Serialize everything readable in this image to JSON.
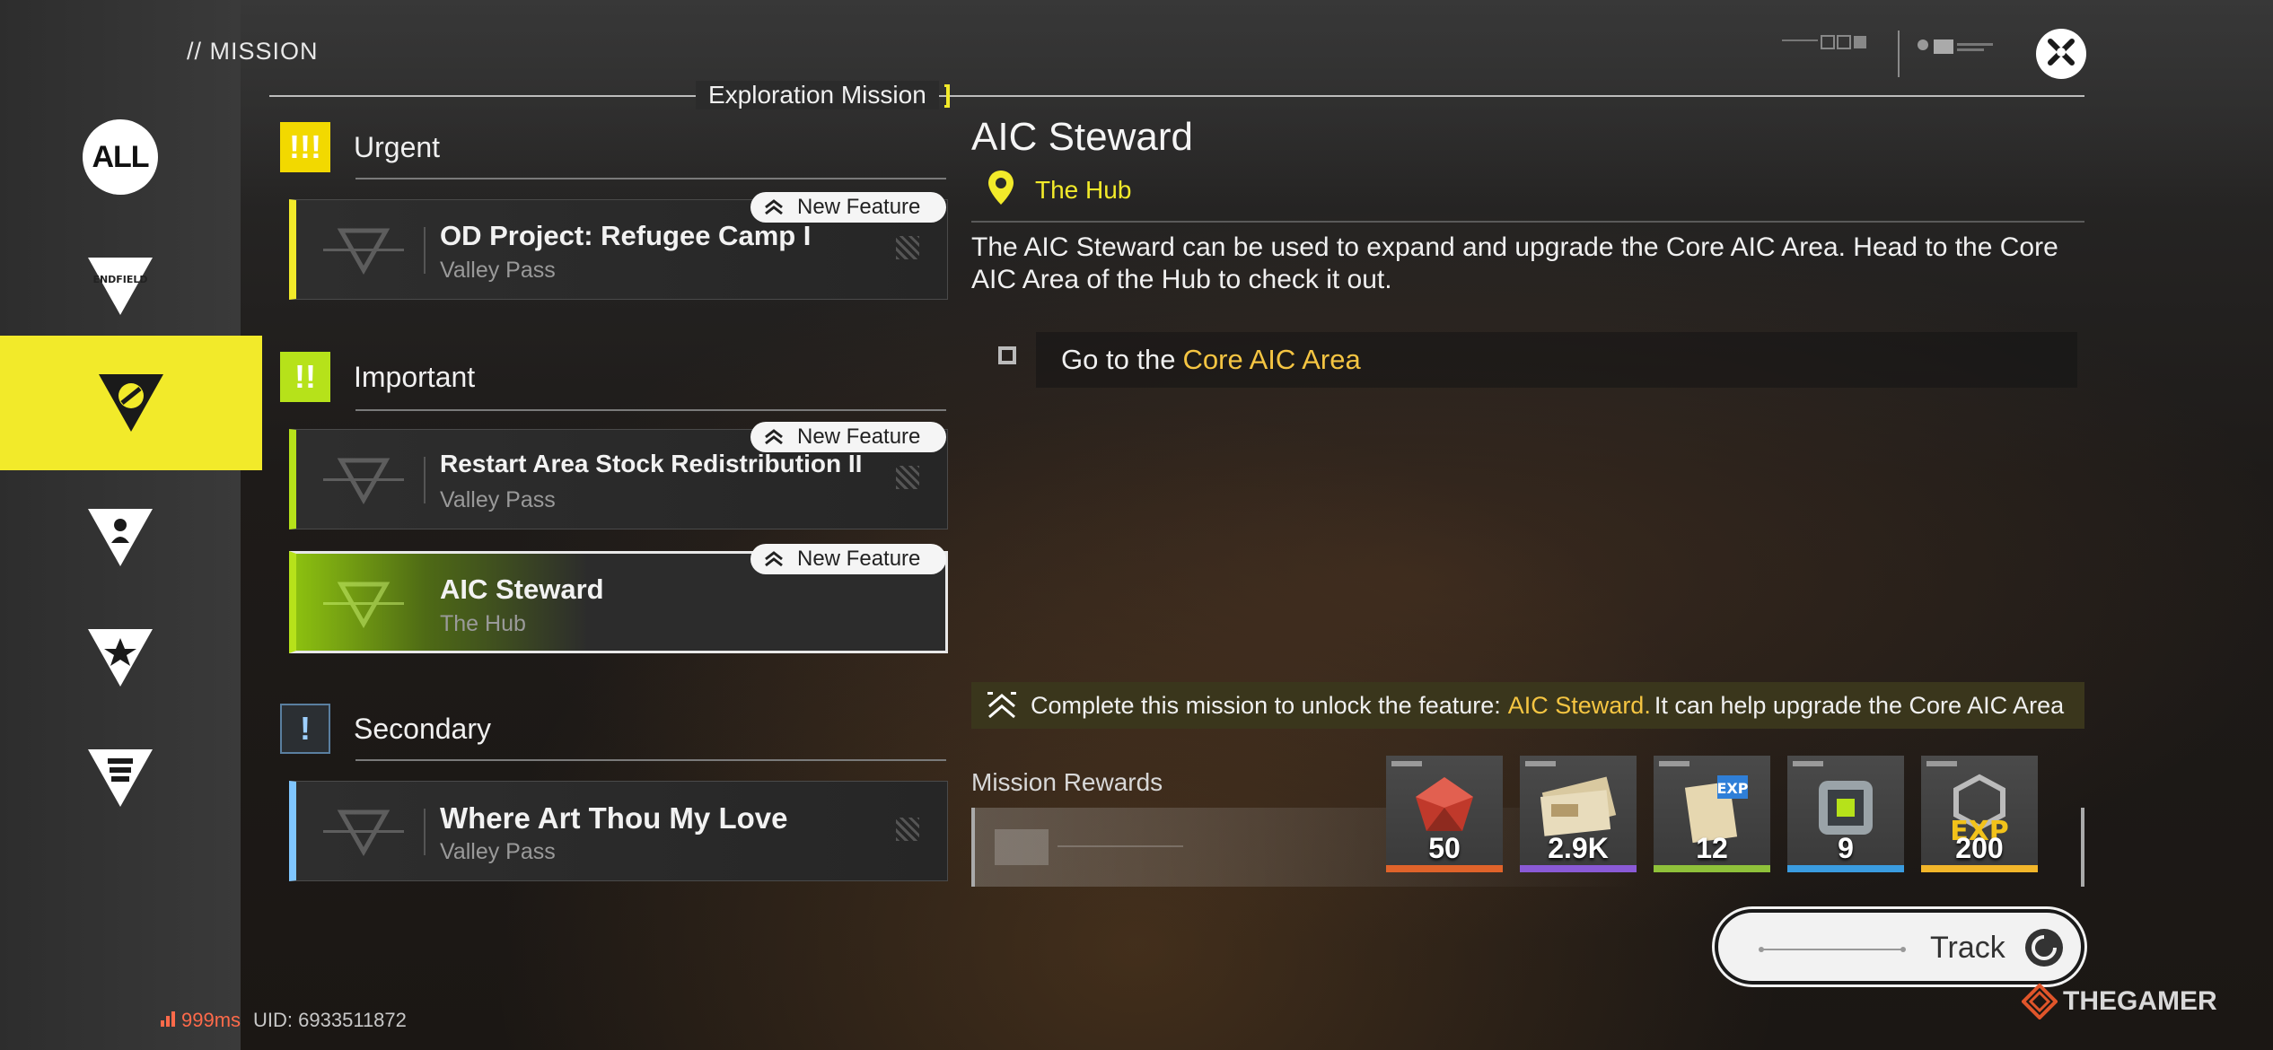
{
  "header": {
    "page_title": "// MISSION",
    "section_tab": "Exploration Mission"
  },
  "sidebar": {
    "items": [
      {
        "name": "all",
        "label": "ALL",
        "active": false
      },
      {
        "name": "endfield",
        "label": "ENDFIELD",
        "active": false
      },
      {
        "name": "exploration",
        "label": "",
        "active": true
      },
      {
        "name": "character",
        "label": "",
        "active": false
      },
      {
        "name": "star",
        "label": "",
        "active": false
      },
      {
        "name": "event",
        "label": "",
        "active": false
      }
    ]
  },
  "groups": {
    "urgent": {
      "label": "Urgent",
      "icon": "!!!"
    },
    "important": {
      "label": "Important",
      "icon": "!!"
    },
    "secondary": {
      "label": "Secondary",
      "icon": "!"
    }
  },
  "missions": [
    {
      "title": "OD Project: Refugee Camp I",
      "location": "Valley Pass",
      "badge": "New Feature",
      "group": "urgent"
    },
    {
      "title": "Restart Area Stock Redistribution II",
      "location": "Valley Pass",
      "badge": "New Feature",
      "group": "important"
    },
    {
      "title": "AIC Steward",
      "location": "The Hub",
      "badge": "New Feature",
      "group": "important",
      "selected": true
    },
    {
      "title": "Where Art Thou My Love",
      "location": "Valley Pass",
      "badge": "",
      "group": "secondary"
    }
  ],
  "detail": {
    "title": "AIC Steward",
    "location": "The Hub",
    "description": "The AIC Steward can be used to expand and upgrade the Core AIC Area. Head to the Core AIC Area of the Hub to check it out.",
    "objective_prefix": "Go to the",
    "objective_highlight": "Core AIC Area",
    "unlock_prefix": "Complete this mission to unlock the feature:",
    "unlock_highlight": "AIC Steward.",
    "unlock_suffix": "It can help upgrade the Core AIC Area",
    "rewards_label": "Mission Rewards",
    "rewards": [
      {
        "count": "50",
        "icon": "red-crystal-icon",
        "color": "#e0632a"
      },
      {
        "count": "2.9K",
        "icon": "currency-notes-icon",
        "color": "#8a5ad6"
      },
      {
        "count": "12",
        "icon": "exp-card-icon",
        "color": "#8fc13a"
      },
      {
        "count": "9",
        "icon": "device-component-icon",
        "color": "#3a9ce0"
      },
      {
        "count": "200",
        "icon": "exp-icon",
        "color": "#f2b62a"
      }
    ]
  },
  "actions": {
    "track_label": "Track"
  },
  "footer": {
    "ping": "999ms",
    "uid": "UID: 6933511872"
  },
  "watermark": "THEGAMER",
  "colors": {
    "accent_yellow": "#f2ea2a",
    "accent_lime": "#b6e21a",
    "accent_blue": "#7fc6ff",
    "highlight_gold": "#f5c542"
  }
}
